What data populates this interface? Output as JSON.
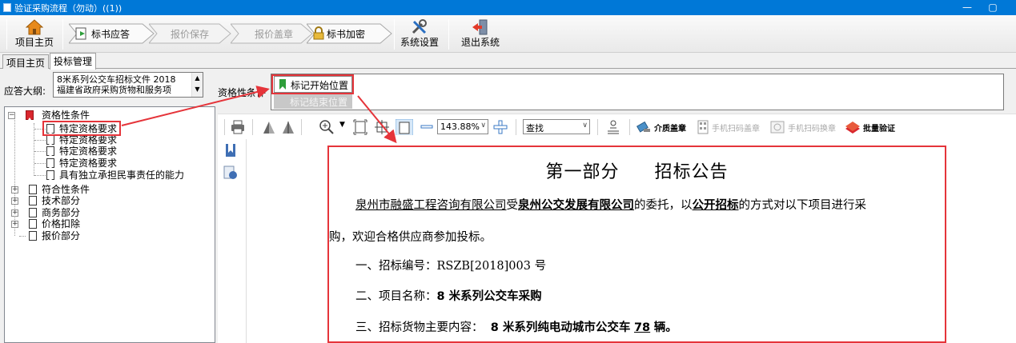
{
  "window": {
    "title": "验证采购流程（勿动）((1))",
    "minimize": "—",
    "restore": "▢"
  },
  "toolbar": {
    "home": "项目主页",
    "bid_response": "标书应答",
    "quote_save": "报价保存",
    "quote_seal": "报价盖章",
    "bid_encrypt": "标书加密",
    "settings": "系统设置",
    "exit": "退出系统"
  },
  "tabs": [
    "项目主页",
    "投标管理"
  ],
  "outline": {
    "label": "应答大纲:",
    "text_line1": "8米系列公交车招标文件 2018",
    "text_line2": "福建省政府采购货物和服务项"
  },
  "tree": {
    "root": "资格性条件",
    "children": [
      "特定资格要求",
      "特定资格要求",
      "特定资格要求",
      "特定资格要求",
      "具有独立承担民事责任的能力"
    ],
    "sections": [
      "符合性条件",
      "技术部分",
      "商务部分",
      "价格扣除",
      "报价部分"
    ]
  },
  "condition": {
    "label": "资格性条件",
    "mark_start": "标记开始位置",
    "mark_end": "标记结束位置"
  },
  "pdf_toolbar": {
    "zoom": "143.88%",
    "search_placeholder": "查找",
    "media_seal": "介质盖章",
    "mobile_scan_seal": "手机扫码盖章",
    "mobile_scan_replace": "手机扫码换章",
    "batch_verify": "批量验证"
  },
  "document": {
    "title_part": "第一部分",
    "title_name": "招标公告",
    "p1_agency": "泉州市融盛工程咨询有限公司",
    "p1_a": "受",
    "p1_client": "泉州公交发展有限公司",
    "p1_b": "的委托，以",
    "p1_method": "公开招标",
    "p1_c": "的方式对以下项目进行采",
    "p1_d": "购，欢迎合格供应商参加投标。",
    "item1_label": "一、招标编号：",
    "item1_value": "RSZB[2018]003 号",
    "item2_label": "二、项目名称：",
    "item2_value": "8 米系列公交车采购",
    "item3_label": "三、招标货物主要内容：",
    "item3_value": "8 米系列纯电动城市公交车",
    "item3_count": "78",
    "item3_unit": "辆。"
  },
  "colors": {
    "titlebar": "#0078d7",
    "annotation_red": "#e5343a",
    "mark_flag": "#2e9e3a"
  }
}
